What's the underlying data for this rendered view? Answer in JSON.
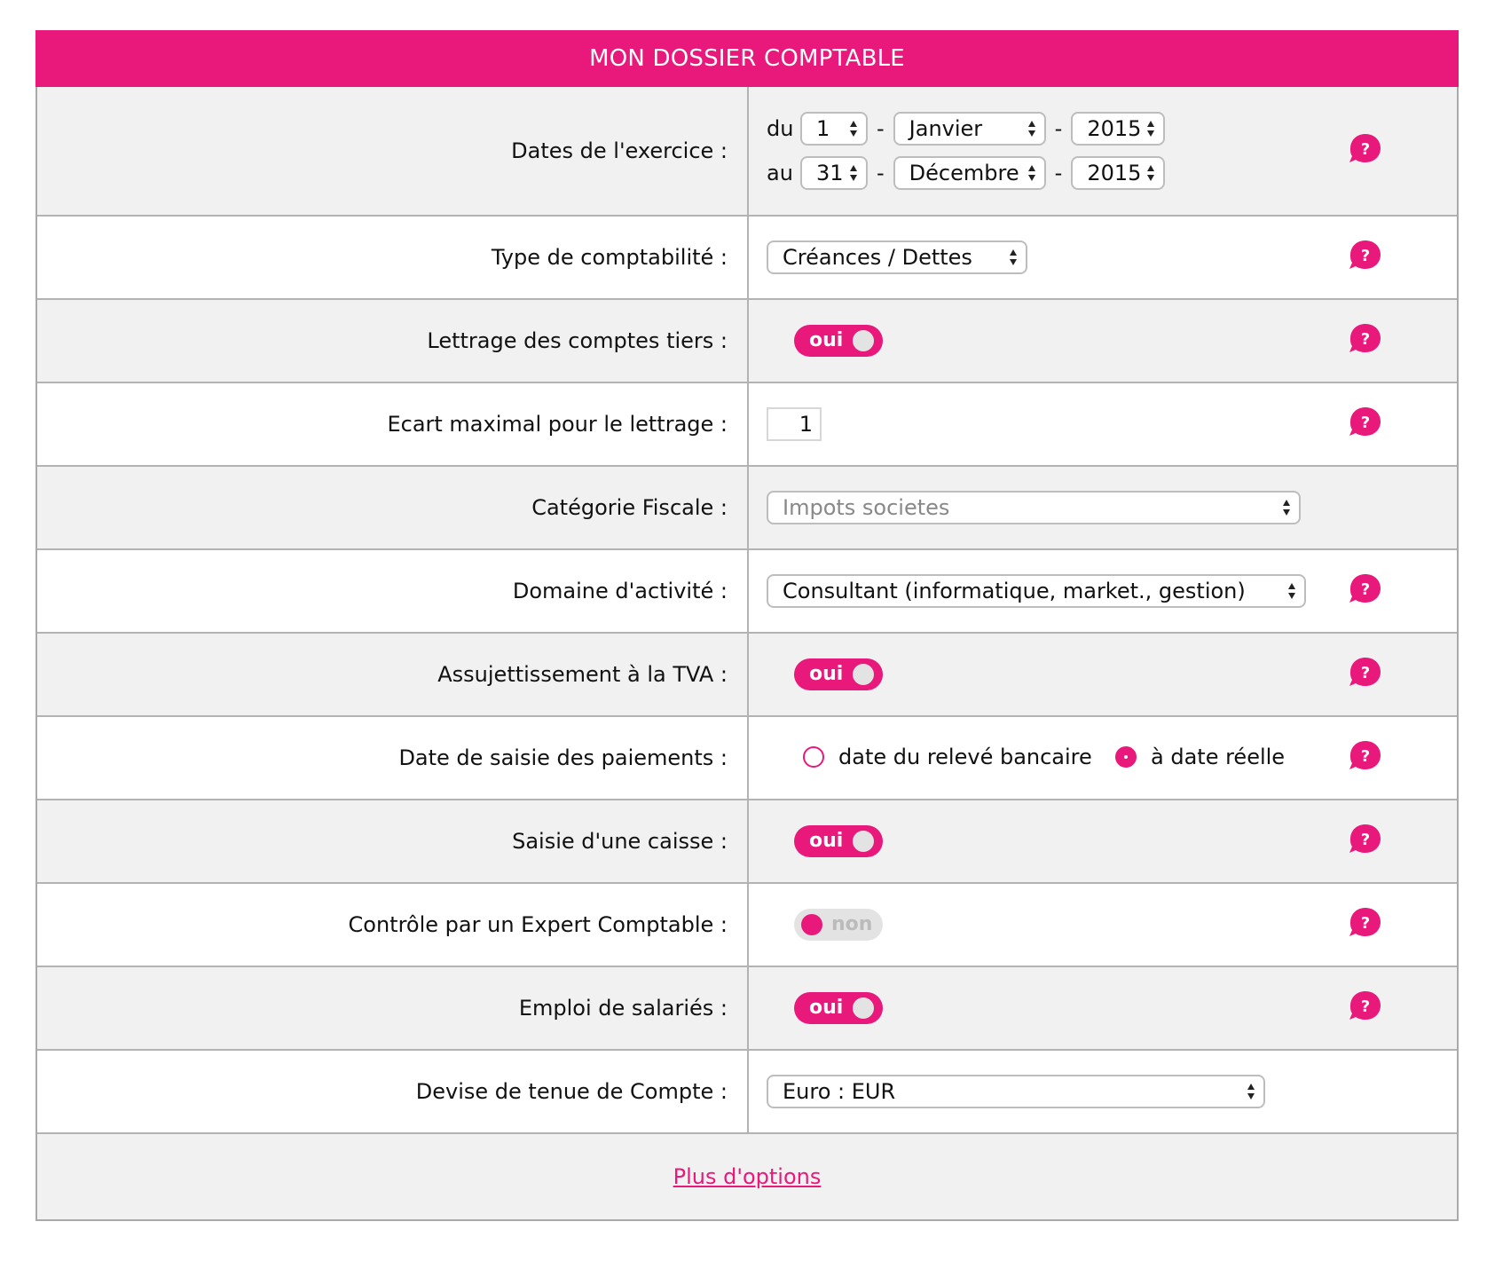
{
  "colors": {
    "accent": "#e8197a",
    "row_grey": "#f1f1f1",
    "border": "#b3b3b3"
  },
  "header": {
    "title": "MON DOSSIER COMPTABLE"
  },
  "exercice": {
    "label": "Dates de l'exercice :",
    "du_label": "du",
    "au_label": "au",
    "separator": "-",
    "start": {
      "day": "1",
      "month": "Janvier",
      "year": "2015"
    },
    "end": {
      "day": "31",
      "month": "Décembre",
      "year": "2015"
    }
  },
  "type_compta": {
    "label": "Type de comptabilité :",
    "value": "Créances / Dettes"
  },
  "lettrage": {
    "label": "Lettrage des comptes tiers :",
    "state": "oui"
  },
  "ecart": {
    "label": "Ecart maximal pour le lettrage :",
    "value": "1"
  },
  "categorie": {
    "label": "Catégorie Fiscale :",
    "value": "Impots societes"
  },
  "domaine": {
    "label": "Domaine d'activité :",
    "value": "Consultant (informatique, market., gestion)"
  },
  "tva": {
    "label": "Assujettissement à la TVA :",
    "state": "oui"
  },
  "paiements": {
    "label": "Date de saisie des paiements :",
    "options": [
      "date du relevé bancaire",
      "à date réelle"
    ],
    "selected": "à date réelle"
  },
  "caisse": {
    "label": "Saisie d'une caisse :",
    "state": "oui"
  },
  "expert": {
    "label": "Contrôle par un Expert Comptable :",
    "state": "non"
  },
  "salaries": {
    "label": "Emploi de salariés :",
    "state": "oui"
  },
  "devise": {
    "label": "Devise de tenue de Compte :",
    "value": "Euro : EUR"
  },
  "footer": {
    "more_options": "Plus d'options"
  },
  "icons": {
    "help": "help-bubble-icon",
    "select_arrows": "updown-arrows-icon"
  }
}
